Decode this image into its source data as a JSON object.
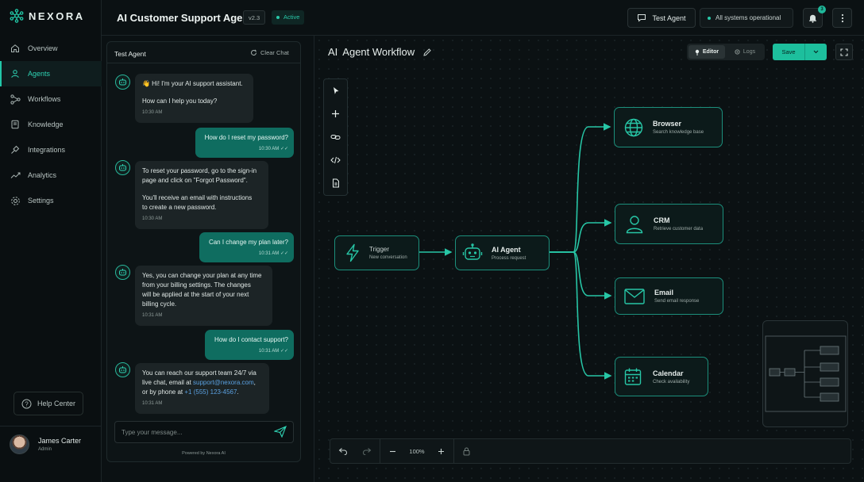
{
  "brand": {
    "name": "NEXORA"
  },
  "nav": {
    "items": [
      {
        "label": "Overview",
        "icon": "home-icon"
      },
      {
        "label": "Agents",
        "icon": "agents-icon",
        "active": true
      },
      {
        "label": "Workflows",
        "icon": "workflow-icon"
      },
      {
        "label": "Knowledge",
        "icon": "book-icon"
      },
      {
        "label": "Integrations",
        "icon": "plug-icon"
      },
      {
        "label": "Analytics",
        "icon": "chart-icon"
      },
      {
        "label": "Settings",
        "icon": "gear-icon"
      }
    ],
    "help_label": "Help Center"
  },
  "user": {
    "name": "James Carter",
    "role": "Admin"
  },
  "header": {
    "title": "AI Customer Support Agent",
    "version": "v2.3",
    "status": "Active",
    "test_agent_label": "Test Agent",
    "system_status": "All systems operational",
    "notification_count": "3"
  },
  "chat": {
    "title": "Test Agent",
    "clear_label": "Clear Chat",
    "placeholder": "Type your message...",
    "powered_by": "Powered by Nexora AI",
    "messages": [
      {
        "role": "bot",
        "lines": [
          "👋 Hi! I'm your AI support assistant.",
          "",
          "How can I help you today?"
        ],
        "time": "10:30 AM"
      },
      {
        "role": "user",
        "text": "How do I reset my password?",
        "time": "10:30 AM"
      },
      {
        "role": "bot",
        "lines": [
          "To reset your password, go to the sign-in",
          "page and click on \"Forgot Password\".",
          "",
          "You'll receive an email with instructions",
          "to create a new password."
        ],
        "time": "10:30 AM"
      },
      {
        "role": "user",
        "text": "Can I change my plan later?",
        "time": "10:31 AM"
      },
      {
        "role": "bot",
        "lines": [
          "Yes, you can change your plan at any time",
          "from your billing settings. The changes",
          "will be applied at the start of your next",
          "billing cycle."
        ],
        "time": "10:31 AM"
      },
      {
        "role": "user",
        "text": "How do I contact support?",
        "time": "10:31 AM"
      },
      {
        "role": "bot",
        "line1": "You can reach our support team 24/7 via",
        "line2_pre": "live chat, email at ",
        "email": "support@nexora.com",
        "line2_post": ",",
        "line3_pre": "or by phone at ",
        "phone": "+1 (555) 123-4567",
        "line3_post": ".",
        "time": "10:31 AM"
      }
    ]
  },
  "workflow": {
    "title_prefix": "AI",
    "title": "Agent Workflow",
    "editor_label": "Editor",
    "logs_label": "Logs",
    "save_label": "Save",
    "zoom": "100%",
    "nodes": {
      "trigger": {
        "title": "Trigger",
        "subtitle": "New conversation",
        "icon": "lightning-icon"
      },
      "agent": {
        "title": "AI Agent",
        "subtitle": "Process request",
        "icon": "robot-icon"
      },
      "browser": {
        "title": "Browser",
        "subtitle": "Search knowledge base",
        "icon": "globe-icon"
      },
      "crm": {
        "title": "CRM",
        "subtitle": "Retrieve customer data",
        "icon": "person-icon"
      },
      "email": {
        "title": "Email",
        "subtitle": "Send email response",
        "icon": "mail-icon"
      },
      "calendar": {
        "title": "Calendar",
        "subtitle": "Check availability",
        "icon": "calendar-icon"
      }
    }
  },
  "colors": {
    "accent": "#1dbf9d",
    "background": "#0b1113",
    "user_bubble": "#0f6d60"
  }
}
